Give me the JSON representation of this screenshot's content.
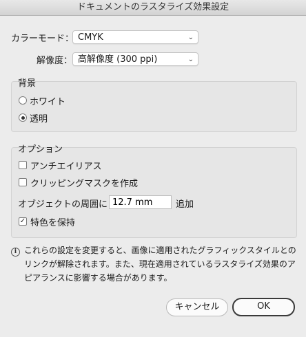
{
  "window": {
    "title": "ドキュメントのラスタライズ効果設定"
  },
  "color_mode": {
    "label": "カラーモード：",
    "value": "CMYK"
  },
  "resolution": {
    "label": "解像度：",
    "value": "高解像度 (300 ppi)"
  },
  "background": {
    "title": "背景",
    "options": [
      {
        "label": "ホワイト",
        "selected": false
      },
      {
        "label": "透明",
        "selected": true
      }
    ]
  },
  "options": {
    "title": "オプション",
    "antialias": {
      "label": "アンチエイリアス",
      "checked": false
    },
    "clipping_mask": {
      "label": "クリッピングマスクを作成",
      "checked": false
    },
    "padding": {
      "label": "オブジェクトの周囲に",
      "value": "12.7 mm",
      "suffix": "追加"
    },
    "preserve_spot": {
      "label": "特色を保持",
      "checked": true
    }
  },
  "info": {
    "lines": [
      "これらの設定を変更すると、画像に適用されたグラフィックスタイルとの",
      "リンクが解除されます。また、現在適用されているラスタライズ効果のア",
      "ピアランスに影響する場合があります。"
    ]
  },
  "buttons": {
    "cancel": "キャンセル",
    "ok": "OK"
  }
}
